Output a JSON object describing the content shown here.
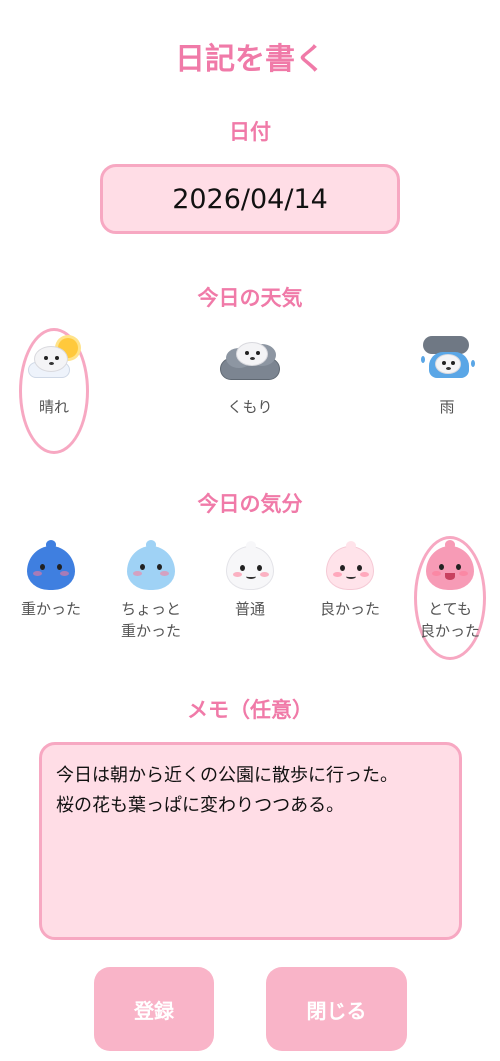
{
  "header": {
    "title": "日記を書く"
  },
  "date": {
    "label": "日付",
    "value": "2026/04/14"
  },
  "weather": {
    "label": "今日の天気",
    "options": [
      {
        "label": "晴れ",
        "icon": "sunny-seal-icon",
        "selected": true
      },
      {
        "label": "くもり",
        "icon": "cloudy-seal-icon",
        "selected": false
      },
      {
        "label": "雨",
        "icon": "rainy-seal-icon",
        "selected": false
      }
    ]
  },
  "mood": {
    "label": "今日の気分",
    "options": [
      {
        "label": "重かった",
        "icon": "blue-blob-sad-icon",
        "selected": false
      },
      {
        "label": "ちょっと\n重かった",
        "icon": "lightblue-blob-icon",
        "selected": false
      },
      {
        "label": "普通",
        "icon": "white-blob-icon",
        "selected": false
      },
      {
        "label": "良かった",
        "icon": "lightpink-blob-icon",
        "selected": false
      },
      {
        "label": "とても\n良かった",
        "icon": "pink-blob-happy-icon",
        "selected": true
      }
    ]
  },
  "memo": {
    "label": "メモ（任意）",
    "value": "今日は朝から近くの公園に散歩に行った。\n桜の花も葉っぱに変わりつつある。"
  },
  "buttons": {
    "register": "登録",
    "close": "閉じる"
  },
  "colors": {
    "accent": "#f07aa8",
    "field_bg": "#ffdde6",
    "field_border": "#f7a8c2",
    "button_bg": "#f9b4c8"
  }
}
